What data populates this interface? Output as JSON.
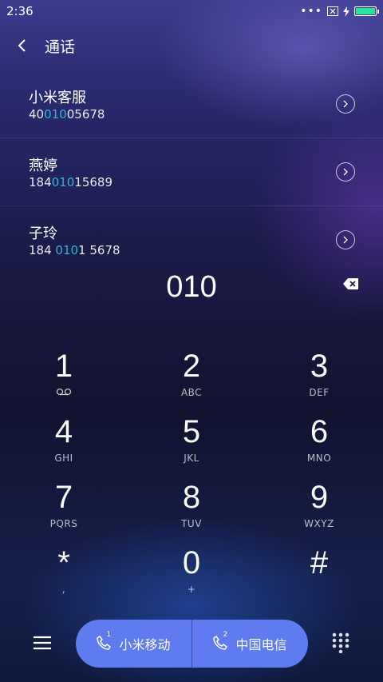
{
  "status": {
    "time": "2:36"
  },
  "header": {
    "title": "通话"
  },
  "contacts": [
    {
      "name": "小米客服",
      "num_pre": "40",
      "num_hl": "010",
      "num_post": "05678"
    },
    {
      "name": "燕婷",
      "num_pre": "184",
      "num_hl": "010",
      "num_post": "15689"
    },
    {
      "name": "子玲",
      "num_pre": "184 ",
      "num_hl": "010",
      "num_post": "1 5678"
    }
  ],
  "dialed": "010",
  "keys": [
    {
      "digit": "1",
      "letters": ""
    },
    {
      "digit": "2",
      "letters": "ABC"
    },
    {
      "digit": "3",
      "letters": "DEF"
    },
    {
      "digit": "4",
      "letters": "GHI"
    },
    {
      "digit": "5",
      "letters": "JKL"
    },
    {
      "digit": "6",
      "letters": "MNO"
    },
    {
      "digit": "7",
      "letters": "PQRS"
    },
    {
      "digit": "8",
      "letters": "TUV"
    },
    {
      "digit": "9",
      "letters": "WXYZ"
    },
    {
      "digit": "*",
      "letters": ","
    },
    {
      "digit": "0",
      "letters": "+"
    },
    {
      "digit": "#",
      "letters": ""
    }
  ],
  "call": {
    "sim1": {
      "index": "1",
      "label": "小米移动"
    },
    "sim2": {
      "index": "2",
      "label": "中国电信"
    }
  },
  "colors": {
    "highlight": "#2fb6d6",
    "call_button": "#5e7cf0",
    "battery": "#2ee0a0"
  },
  "icons": {
    "back": "chevron-left-icon",
    "voicemail": "voicemail-icon",
    "backspace": "backspace-icon",
    "menu": "menu-icon",
    "dialpad": "dialpad-icon"
  }
}
